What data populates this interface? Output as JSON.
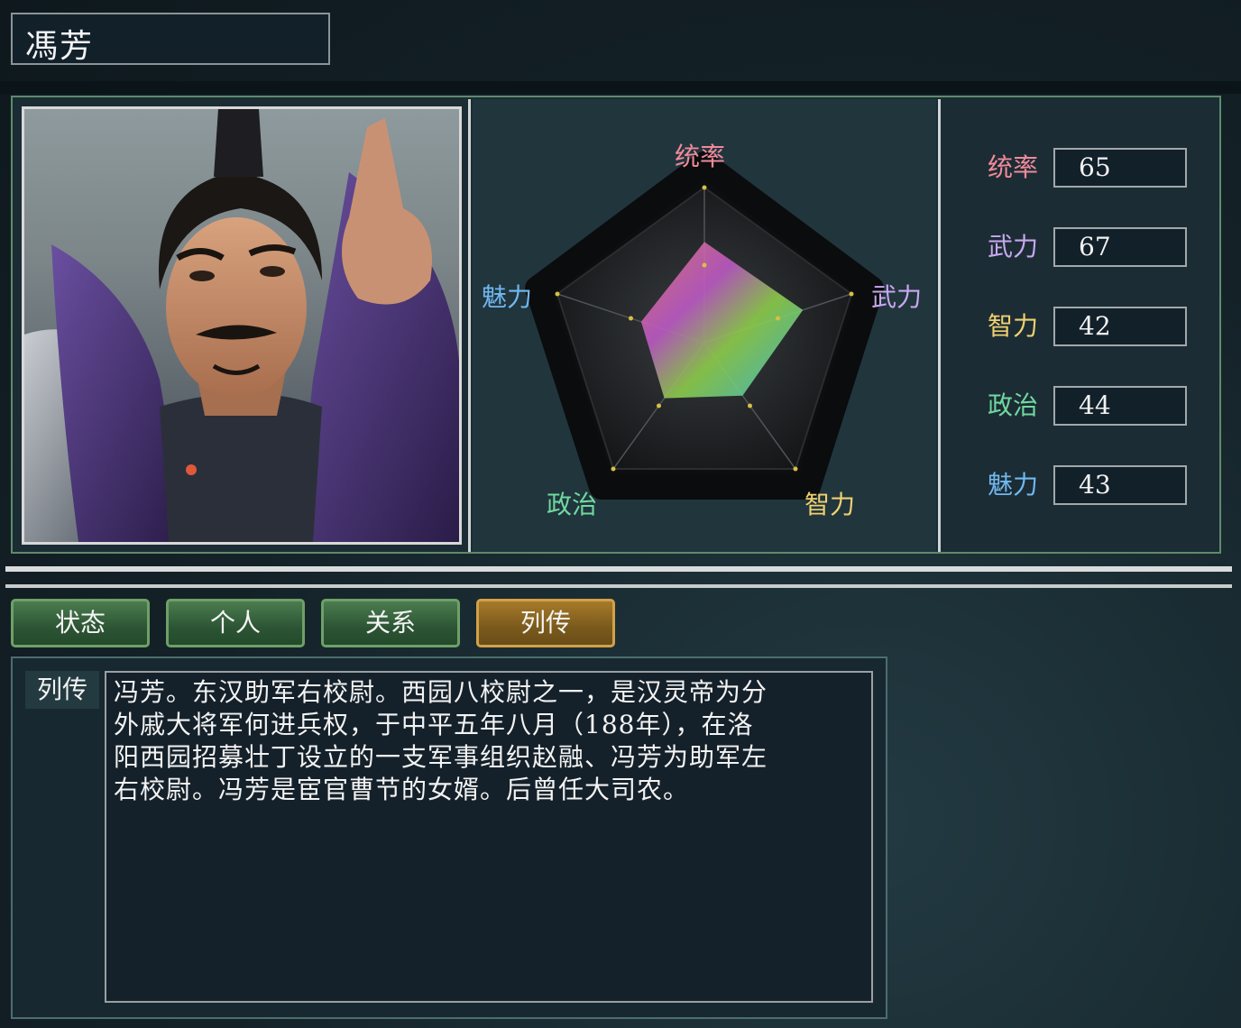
{
  "character": {
    "name": "馮芳"
  },
  "radar": {
    "labels": {
      "command": "统率",
      "war": "武力",
      "intelligence": "智力",
      "politics": "政治",
      "charm": "魅力"
    },
    "colors": {
      "command": "#f08a9a",
      "war": "#c8a8f0",
      "intelligence": "#f0d070",
      "politics": "#70d8a0",
      "charm": "#70b8f0"
    }
  },
  "stats": [
    {
      "label": "统率",
      "value": "65",
      "color": "#f08a9a"
    },
    {
      "label": "武力",
      "value": "67",
      "color": "#c8a8f0"
    },
    {
      "label": "智力",
      "value": "42",
      "color": "#f0d070"
    },
    {
      "label": "政治",
      "value": "44",
      "color": "#70d8a0"
    },
    {
      "label": "魅力",
      "value": "43",
      "color": "#70b8f0"
    }
  ],
  "tabs": [
    {
      "label": "状态",
      "active": false
    },
    {
      "label": "个人",
      "active": false
    },
    {
      "label": "关系",
      "active": false
    },
    {
      "label": "列传",
      "active": true
    }
  ],
  "biography": {
    "label": "列传",
    "lines": [
      "冯芳。东汉助军右校尉。西园八校尉之一，是汉灵帝为分",
      "外戚大将军何进兵权，于中平五年八月（188年），在洛",
      "阳西园招募壮丁设立的一支军事组织赵融、冯芳为助军左",
      "右校尉。冯芳是宦官曹节的女婿。后曾任大司农。"
    ]
  }
}
